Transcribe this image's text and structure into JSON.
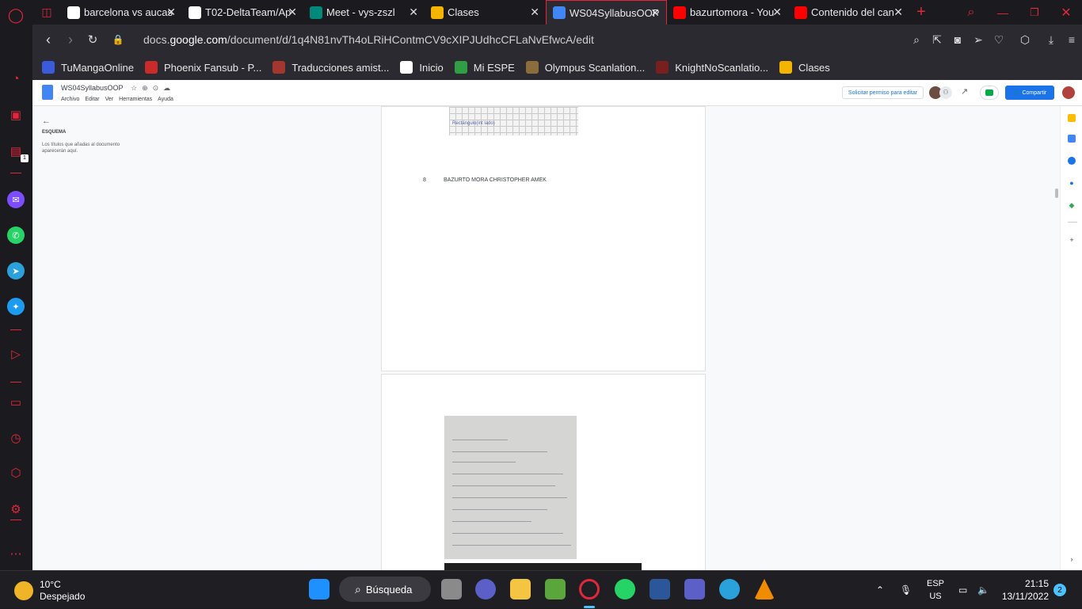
{
  "browser": {
    "tabs": [
      {
        "title": "barcelona vs aucas",
        "icon": "google-icon",
        "color": "#ffffff"
      },
      {
        "title": "T02-DeltaTeam/Ap",
        "icon": "github-icon",
        "color": "#ffffff"
      },
      {
        "title": "Meet - vys-zszl",
        "icon": "meet-icon",
        "color": "#00897b"
      },
      {
        "title": "Clases",
        "icon": "classroom-icon",
        "color": "#f4b400"
      },
      {
        "title": "WS04SyllabusOOP",
        "icon": "docs-icon",
        "color": "#4285f4",
        "active": true
      },
      {
        "title": "bazurtomora - You",
        "icon": "youtube-icon",
        "color": "#ff0000"
      },
      {
        "title": "Contenido del can",
        "icon": "youtube-icon",
        "color": "#ff0000"
      }
    ],
    "address": {
      "prefix": "docs.",
      "domain": "google.com",
      "path": "/document/d/1q4N81nvTh4oLRiHContmCV9cXIPJUdhcCFLaNvEfwcA/edit"
    },
    "bookmarks": [
      {
        "label": "TuMangaOnline",
        "color": "#3b5bdb"
      },
      {
        "label": "Phoenix Fansub - P...",
        "color": "#c92a2a"
      },
      {
        "label": "Traducciones amist...",
        "color": "#a3362e"
      },
      {
        "label": "Inicio",
        "color": "#ffffff"
      },
      {
        "label": "Mi ESPE",
        "color": "#2f9e44"
      },
      {
        "label": "Olympus Scanlation...",
        "color": "#8a6d3b"
      },
      {
        "label": "KnightNoScanlatio...",
        "color": "#7a1f1f"
      },
      {
        "label": "Clases",
        "color": "#f4b400"
      }
    ],
    "sidebar_badge": "1"
  },
  "docs": {
    "title": "WS04SyllabusOOP",
    "menu": [
      "Archivo",
      "Editar",
      "Ver",
      "Herramientas",
      "Ayuda"
    ],
    "request_edit": "Solicitar permiso para editar",
    "share": "Compartir",
    "outline": {
      "heading": "ESQUEMA",
      "hint": "Los títulos que añadas al documento aparecerán aquí."
    },
    "page_number": "8",
    "footer_name": "BAZURTO MORA CHRISTOPHER AMEK",
    "image_scribble": "Rectángulo(int lado)"
  },
  "taskbar": {
    "temperature": "10°C",
    "condition": "Despejado",
    "search": "Búsqueda",
    "lang": "ESP",
    "region": "US",
    "time": "21:15",
    "date": "13/11/2022",
    "notifications": "2"
  }
}
